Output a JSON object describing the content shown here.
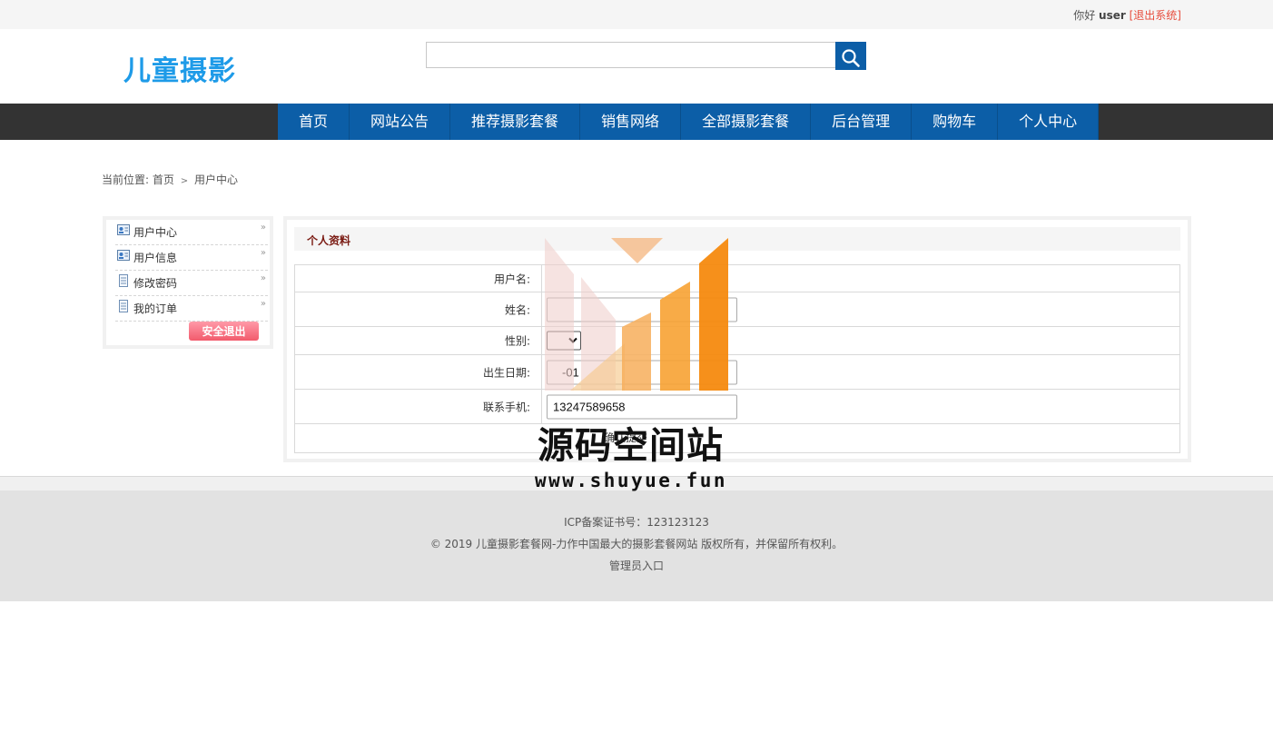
{
  "topbar": {
    "greeting": "你好",
    "username": "user",
    "logout_label": "[退出系统]"
  },
  "header": {
    "logo_text": "儿童摄影",
    "search": {
      "value": "",
      "placeholder": ""
    }
  },
  "nav": {
    "items": [
      "首页",
      "网站公告",
      "推荐摄影套餐",
      "销售网络",
      "全部摄影套餐",
      "后台管理",
      "购物车",
      "个人中心"
    ]
  },
  "breadcrumb": {
    "prefix": "当前位置:",
    "home": "首页",
    "current": "用户中心"
  },
  "sidebar": {
    "items": [
      {
        "label": "用户中心",
        "icon": "user-card-icon"
      },
      {
        "label": "用户信息",
        "icon": "user-card-icon"
      },
      {
        "label": "修改密码",
        "icon": "document-icon"
      },
      {
        "label": "我的订单",
        "icon": "document-icon"
      }
    ],
    "exit_label": "安全退出"
  },
  "profile": {
    "title": "个人资料",
    "fields": {
      "username_label": "用户名:",
      "username_value": "",
      "name_label": "姓名:",
      "name_value": "",
      "gender_label": "性别:",
      "gender_value": "",
      "birthday_label": "出生日期:",
      "birthday_value": "-01",
      "phone_label": "联系手机:",
      "phone_value": "13247589658"
    },
    "submit_label": "确认提交"
  },
  "footer": {
    "icp": "ICP备案证书号：123123123",
    "copyright": "© 2019 儿童摄影套餐网-力作中国最大的摄影套餐网站 版权所有，并保留所有权利。",
    "admin_link": "管理员入口"
  },
  "watermark": {
    "title": "源码空间站",
    "url": "www.shuyue.fun"
  },
  "colors": {
    "nav_blue": "#0c5ea7",
    "nav_bar": "#333333",
    "logo": "#1e9be8",
    "logout": "#e74c3c",
    "exit_button": "#f25a6c"
  }
}
